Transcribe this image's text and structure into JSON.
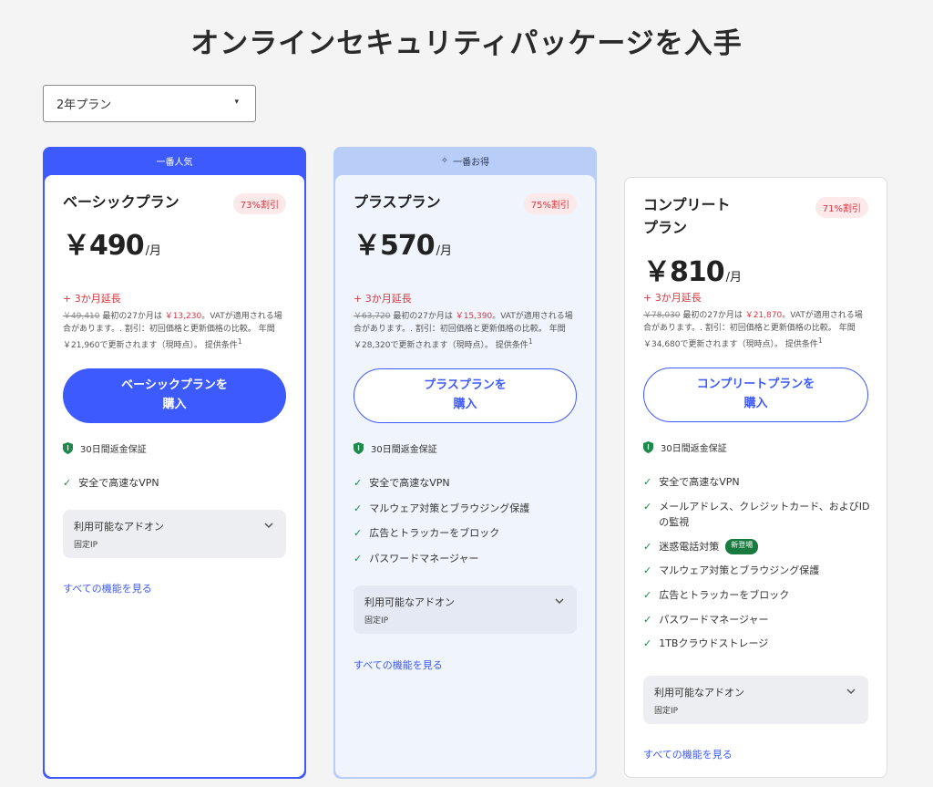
{
  "page": {
    "title": "オンラインセキュリティパッケージを入手"
  },
  "plan_select": {
    "value": "2年プラン",
    "caret": "▾"
  },
  "common": {
    "guarantee": "30日間返金保証",
    "addon_title": "利用可能なアドオン",
    "addon_item": "固定IP",
    "see_all": "すべての機能を見る",
    "price_unit": "/月",
    "extension": "+ 3か月延長",
    "check": "✓"
  },
  "plans": [
    {
      "ribbon": "一番人気",
      "name": "ベーシックプラン",
      "discount": "73%割引",
      "price": "￥490",
      "regular": "￥49,410",
      "first_label": "最初の27か月は",
      "first_price": "￥13,230",
      "tax_note": "。VATが適用される場合があります。. 割引：初回価格と更新価格の比較。",
      "renewal": "年間￥21,960で更新されます（現時点）。 提供条件",
      "sup": "1",
      "button": "ベーシックプランを\n購入",
      "features": [
        "安全で高速なVPN"
      ]
    },
    {
      "ribbon": "一番お得",
      "ribbon_icon": "✧",
      "name": "プラスプラン",
      "discount": "75%割引",
      "price": "￥570",
      "regular": "￥63,720",
      "first_label": "最初の27か月は",
      "first_price": "￥15,390",
      "tax_note": "。VATが適用される場合があります。. 割引：初回価格と更新価格の比較。",
      "renewal": "年間￥28,320で更新されます（現時点）。 提供条件",
      "sup": "1",
      "button": "プラスプランを\n購入",
      "features": [
        "安全で高速なVPN",
        "マルウェア対策とブラウジング保護",
        "広告とトラッカーをブロック",
        "パスワードマネージャー"
      ]
    },
    {
      "name": "コンプリート\nプラン",
      "discount": "71%割引",
      "price": "￥810",
      "regular": "￥78,030",
      "first_label": "最初の27か月は",
      "first_price": "￥21,870",
      "tax_note": "。VATが適用される場合があります。. 割引：初回価格と更新価格の比較。",
      "renewal": "年間￥34,680で更新されます（現時点）。 提供条件",
      "sup": "1",
      "button": "コンプリートプランを\n購入",
      "features": [
        "安全で高速なVPN",
        "メールアドレス、クレジットカード、およびIDの監視",
        "迷惑電話対策",
        "マルウェア対策とブラウジング保護",
        "広告とトラッカーをブロック",
        "パスワードマネージャー",
        "1TBクラウドストレージ"
      ],
      "new_badge": "新登場"
    }
  ],
  "colors": {
    "accent": "#3d5afe",
    "discount": "#d9363e",
    "check": "#1d8a4a",
    "new_badge": "#187a3f"
  }
}
